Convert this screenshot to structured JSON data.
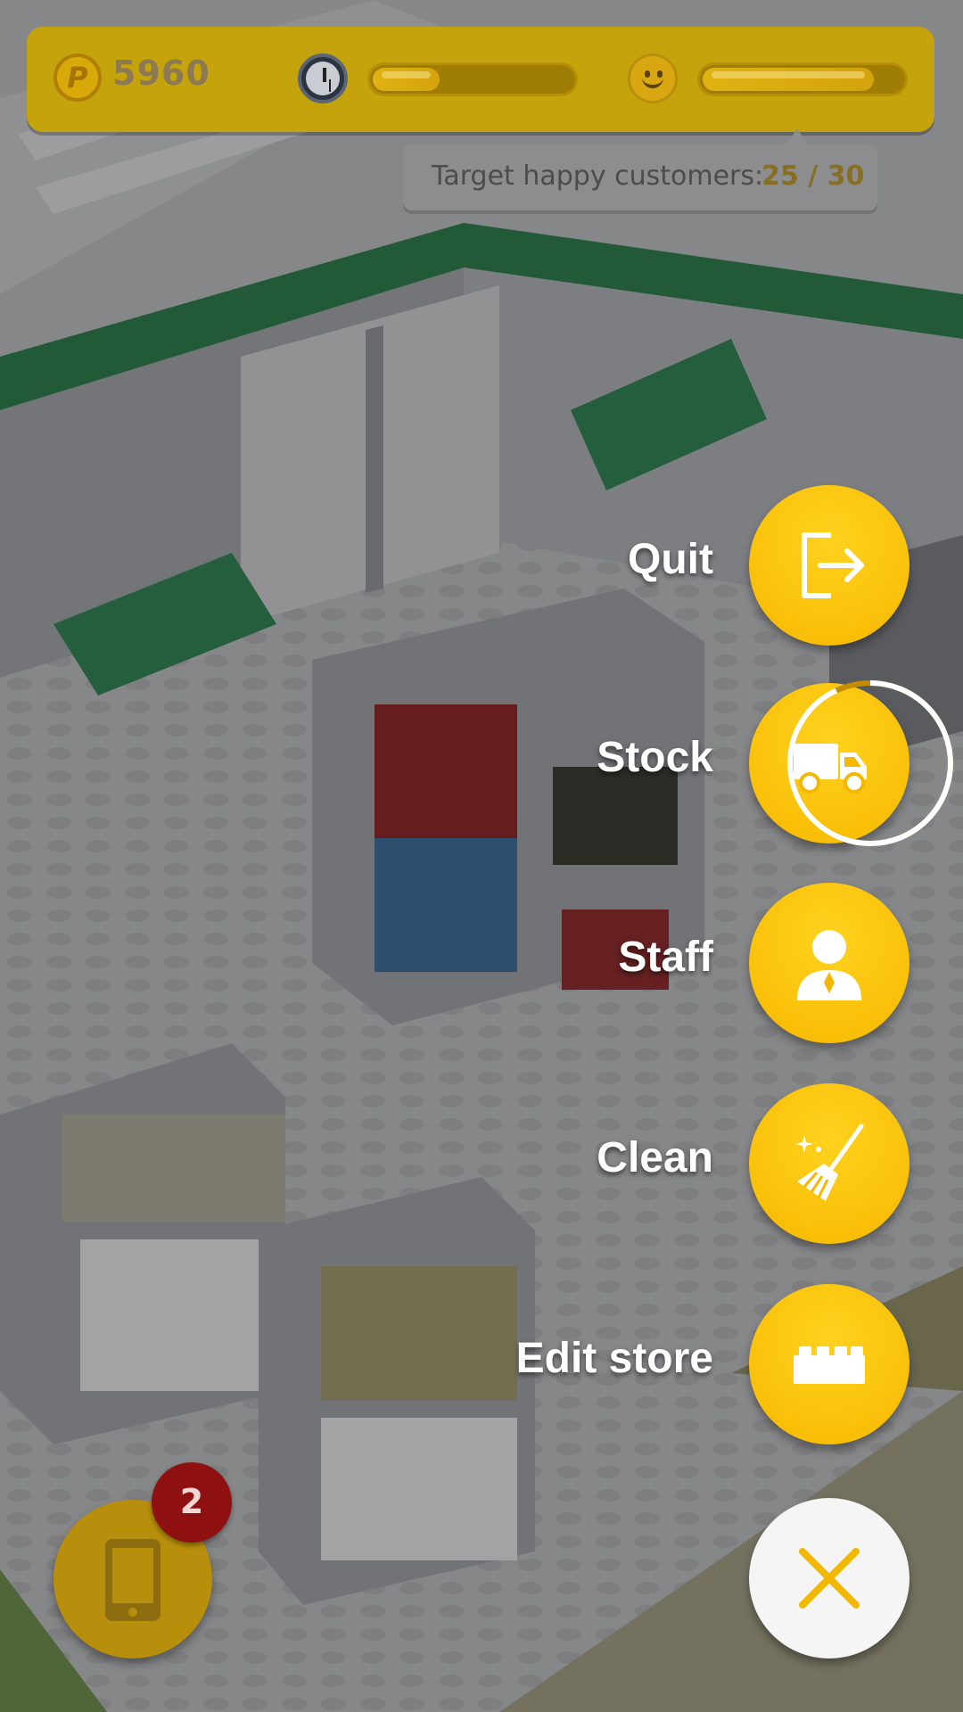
{
  "hud": {
    "coins": "5960",
    "coin_symbol": "P",
    "time_progress": 0.35,
    "happiness_progress": 0.86
  },
  "target": {
    "label": "Target happy customers:",
    "value": "25 / 30"
  },
  "menu": {
    "items": [
      {
        "label": "Quit",
        "icon": "exit-icon"
      },
      {
        "label": "Stock",
        "icon": "truck-icon",
        "progress": 0.93
      },
      {
        "label": "Staff",
        "icon": "staff-person-icon"
      },
      {
        "label": "Clean",
        "icon": "broom-icon"
      },
      {
        "label": "Edit store",
        "icon": "brick-icon"
      }
    ],
    "close_icon": "close-x-icon"
  },
  "phone": {
    "icon": "phone-icon",
    "notifications": "2"
  },
  "colors": {
    "button_yellow": "#ffc400",
    "hud_bg": "#c4a30c",
    "badge_red": "#8e1010"
  }
}
